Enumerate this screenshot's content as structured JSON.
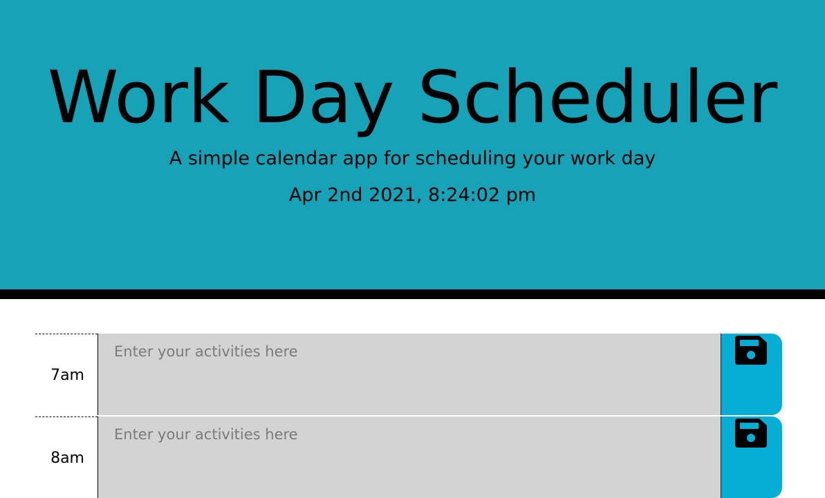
{
  "header": {
    "title": "Work Day Scheduler",
    "subtitle": "A simple calendar app for scheduling your work day",
    "current_day": "Apr 2nd 2021, 8:24:02 pm"
  },
  "time_blocks": [
    {
      "hour": "7am",
      "placeholder": "Enter your activities here",
      "value": "",
      "save_icon": "floppy-disk-icon"
    },
    {
      "hour": "8am",
      "placeholder": "Enter your activities here",
      "value": "",
      "save_icon": "floppy-disk-icon"
    }
  ],
  "colors": {
    "header_background": "#17a2b8",
    "header_border": "#000000",
    "past_row": "#d3d3d3",
    "save_button": "#06aed5"
  }
}
